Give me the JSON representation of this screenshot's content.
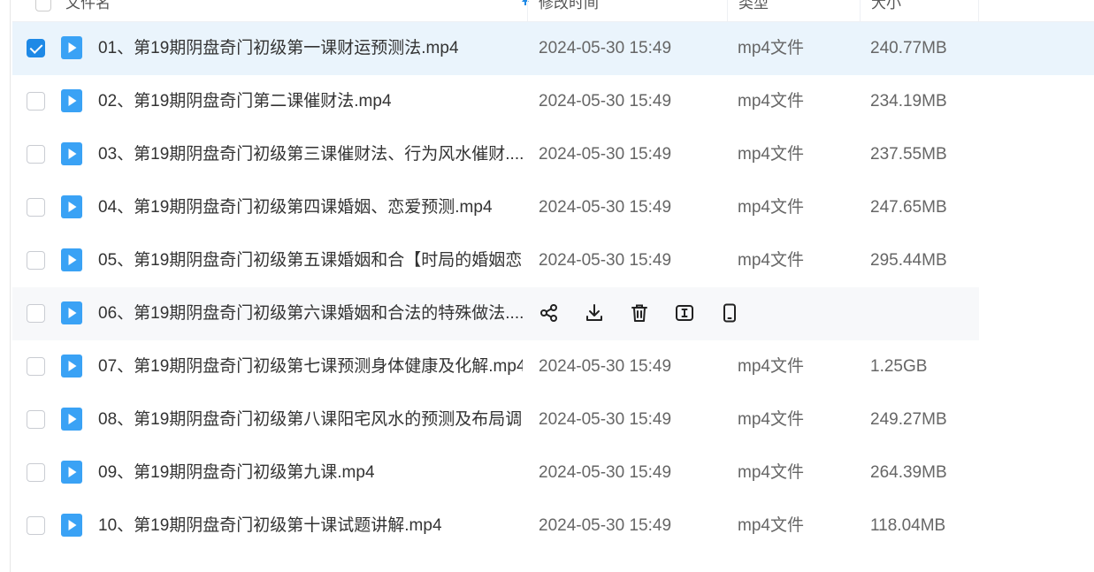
{
  "header": {
    "name_col": "文件名",
    "modified_col": "修改时间",
    "type_col": "类型",
    "size_col": "大小"
  },
  "files": [
    {
      "name": "01、第19期阴盘奇门初级第一课财运预测法.mp4",
      "modified": "2024-05-30 15:49",
      "type": "mp4文件",
      "size": "240.77MB",
      "checked": true
    },
    {
      "name": "02、第19期阴盘奇门第二课催财法.mp4",
      "modified": "2024-05-30 15:49",
      "type": "mp4文件",
      "size": "234.19MB",
      "checked": false
    },
    {
      "name": "03、第19期阴盘奇门初级第三课催财法、行为风水催财....",
      "modified": "2024-05-30 15:49",
      "type": "mp4文件",
      "size": "237.55MB",
      "checked": false
    },
    {
      "name": "04、第19期阴盘奇门初级第四课婚姻、恋爱预测.mp4",
      "modified": "2024-05-30 15:49",
      "type": "mp4文件",
      "size": "247.65MB",
      "checked": false
    },
    {
      "name": "05、第19期阴盘奇门初级第五课婚姻和合【时局的婚姻恋...",
      "modified": "2024-05-30 15:49",
      "type": "mp4文件",
      "size": "295.44MB",
      "checked": false
    },
    {
      "name": "06、第19期阴盘奇门初级第六课婚姻和合法的特殊做法....",
      "modified": "",
      "type": "",
      "size": "",
      "checked": false,
      "hover": true
    },
    {
      "name": "07、第19期阴盘奇门初级第七课预测身体健康及化解.mp4",
      "modified": "2024-05-30 15:49",
      "type": "mp4文件",
      "size": "1.25GB",
      "checked": false
    },
    {
      "name": "08、第19期阴盘奇门初级第八课阳宅风水的预测及布局调...",
      "modified": "2024-05-30 15:49",
      "type": "mp4文件",
      "size": "249.27MB",
      "checked": false
    },
    {
      "name": "09、第19期阴盘奇门初级第九课.mp4",
      "modified": "2024-05-30 15:49",
      "type": "mp4文件",
      "size": "264.39MB",
      "checked": false
    },
    {
      "name": "10、第19期阴盘奇门初级第十课试题讲解.mp4",
      "modified": "2024-05-30 15:49",
      "type": "mp4文件",
      "size": "118.04MB",
      "checked": false
    }
  ],
  "row_actions": [
    "share-icon",
    "download-icon",
    "delete-icon",
    "rename-icon",
    "phone-icon"
  ],
  "colors": {
    "accent": "#1e89e6",
    "selected_row": "#eaf4fc",
    "hover_row": "#f7f8fa",
    "file_icon": "#3aa2f5"
  }
}
